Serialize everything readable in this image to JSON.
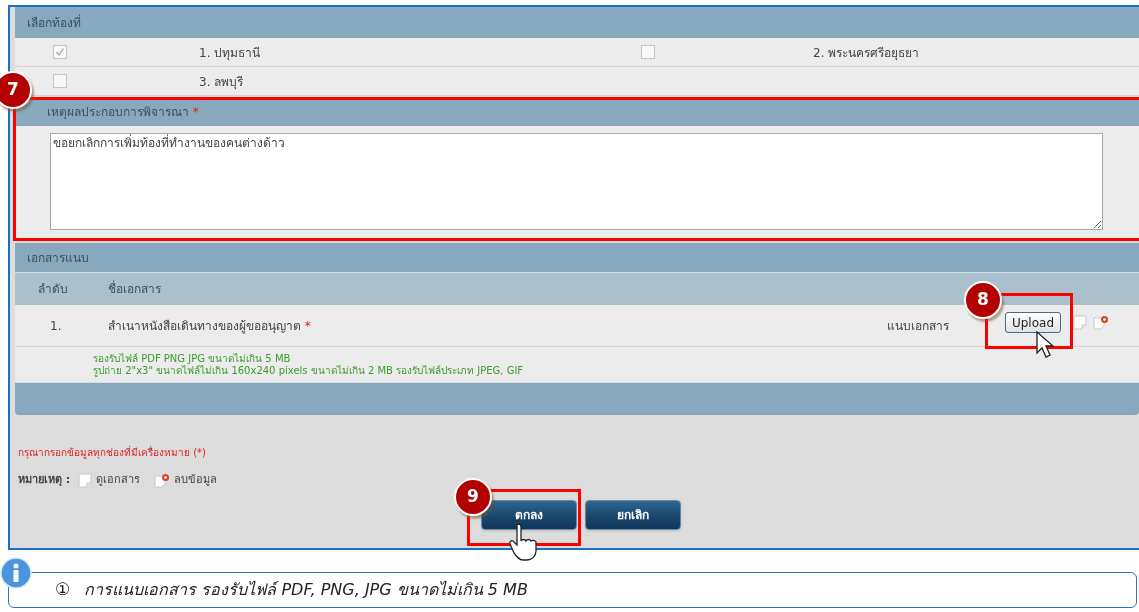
{
  "area_section": {
    "title": "เลือกท้องที่",
    "options": [
      {
        "label": "1. ปทุมธานี",
        "checked": true
      },
      {
        "label": "2. พระนครศรีอยุธยา",
        "checked": false
      },
      {
        "label": "3. ลพบุรี",
        "checked": false
      }
    ]
  },
  "reason_section": {
    "title": "เหตุผลประกอบการพิจารณา",
    "required_mark": "*",
    "value": "ขอยกเลิกการเพิ่มท้องที่ทำงานของคนต่างด้าว"
  },
  "attachments": {
    "title": "เอกสารแนบ",
    "columns": [
      "ลำดับ",
      "ชื่อเอกสาร"
    ],
    "rows": [
      {
        "index": "1.",
        "name": "สำเนาหนังสือเดินทางของผู้ขออนุญาต",
        "required_mark": "*",
        "attach_label": "แนบเอกสาร",
        "upload_button": "Upload"
      }
    ],
    "notes": [
      "รองรับไฟล์ PDF PNG JPG ขนาดไม่เกิน 5 MB",
      "รูปถ่าย 2\"x3\" ขนาดไฟล์ไม่เกิน 160x240 pixels ขนาดไม่เกิน 2 MB รองรับไฟล์ประเภท JPEG, GIF"
    ]
  },
  "required_note": "กรุณากรอกข้อมูลทุกช่องที่มีเครื่องหมาย (*)",
  "legend": {
    "label": "หมายเหตุ :",
    "items": [
      {
        "kind": "view",
        "label": "ดูเอกสาร"
      },
      {
        "kind": "delete",
        "label": "ลบข้อมูล"
      }
    ]
  },
  "buttons": [
    "ตกลง",
    "ยกเลิก"
  ],
  "callouts": [
    "7",
    "8",
    "9"
  ],
  "info": {
    "marker": "①",
    "text": "การแนบเอกสาร รองรับไฟล์ PDF, PNG, JPG ขนาดไม่เกิน 5 MB"
  }
}
